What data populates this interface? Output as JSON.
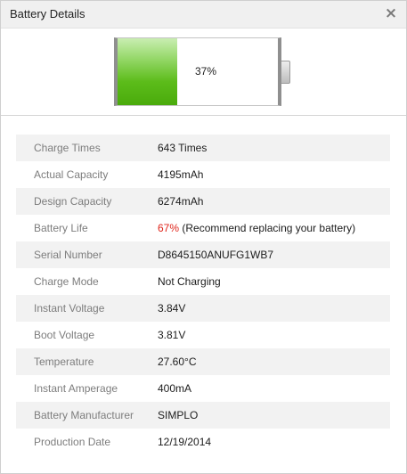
{
  "window": {
    "title": "Battery Details",
    "close_glyph": "×"
  },
  "battery": {
    "percent_label": "37%",
    "charge_fraction": 0.37,
    "fill_color": "#5cbc1a"
  },
  "details": [
    {
      "label": "Charge Times",
      "value": "643 Times"
    },
    {
      "label": "Actual Capacity",
      "value": "4195mAh"
    },
    {
      "label": "Design Capacity",
      "value": "6274mAh"
    },
    {
      "label": "Battery Life",
      "value_highlight": "67%",
      "value_rest": " (Recommend replacing your battery)"
    },
    {
      "label": "Serial Number",
      "value": "D8645150ANUFG1WB7"
    },
    {
      "label": "Charge Mode",
      "value": "Not Charging"
    },
    {
      "label": "Instant Voltage",
      "value": "3.84V"
    },
    {
      "label": "Boot Voltage",
      "value": "3.81V"
    },
    {
      "label": "Temperature",
      "value": "27.60°C"
    },
    {
      "label": "Instant Amperage",
      "value": "400mA"
    },
    {
      "label": "Battery Manufacturer",
      "value": "SIMPLO"
    },
    {
      "label": "Production Date",
      "value": "12/19/2014"
    }
  ],
  "colors": {
    "warning": "#e0261c",
    "row_alt": "#f2f2f2"
  }
}
